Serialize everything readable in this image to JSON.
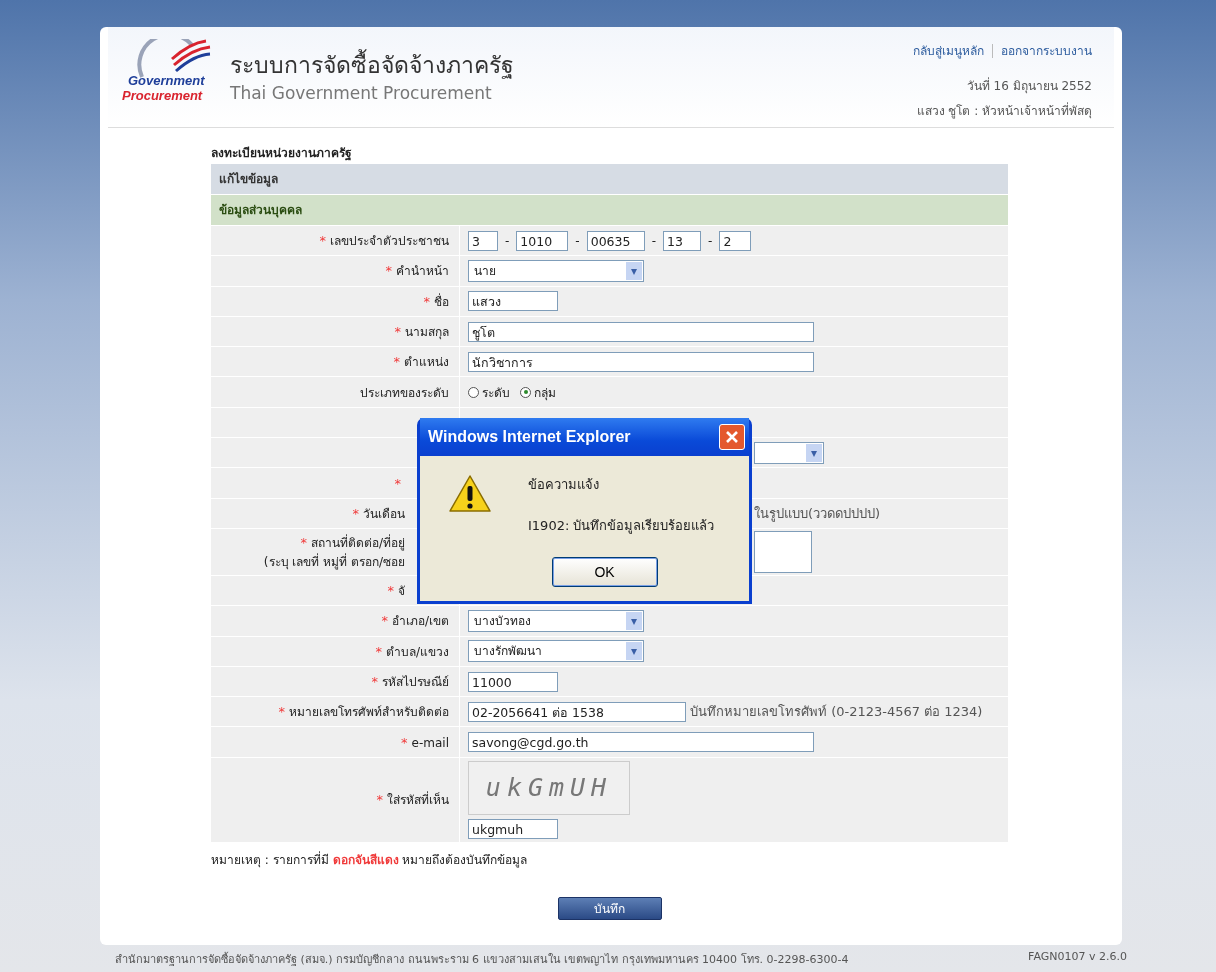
{
  "header": {
    "logo": {
      "line_1": "Government",
      "line_2": "Procurement"
    },
    "title": "ระบบการจัดซื้อจัดจ้างภาครัฐ",
    "subtitle": "Thai Government Procurement",
    "links": [
      "กลับสู่เมนูหลัก",
      "ออกจากระบบงาน"
    ],
    "date": "วันที่ 16 มิถุนายน 2552",
    "user": "แสวง ชูโต : หัวหน้าเจ้าหน้าที่พัสดุ"
  },
  "form": {
    "title": "ลงทะเบียนหน่วยงานภาครัฐ",
    "section": "แก้ไขข้อมูล",
    "subsection": "ข้อมูลส่วนบุคคล",
    "rows": [
      {
        "kind": "id",
        "label": "เลขประจำตัวประชาชน",
        "required": true,
        "obscured": false,
        "parts": [
          "3",
          "1010",
          "00635",
          "13",
          "2"
        ]
      },
      {
        "kind": "select",
        "label": "คำนำหน้า",
        "required": true,
        "obscured": false,
        "value": "นาย"
      },
      {
        "kind": "short_text",
        "label": "ชื่อ",
        "required": true,
        "obscured": false,
        "value": "แสวง"
      },
      {
        "kind": "text",
        "label": "นามสกุล",
        "required": true,
        "obscured": false,
        "value": "ชูโต"
      },
      {
        "kind": "text",
        "label": "ตำแหน่ง",
        "required": true,
        "obscured": false,
        "value": "นักวิชาการ"
      },
      {
        "kind": "radio",
        "label": "ประเภทของระดับ",
        "required": false,
        "obscured": false,
        "options": [
          {
            "label": "ระดับ",
            "selected": false
          },
          {
            "label": "กลุ่ม",
            "selected": true
          }
        ]
      },
      {
        "kind": "blank",
        "required": false
      },
      {
        "kind": "blank_select",
        "required": false,
        "obscured": true
      },
      {
        "kind": "blank",
        "required": true,
        "obscured": true
      },
      {
        "kind": "hint",
        "label": "วันเดือน",
        "required": true,
        "obscured": true,
        "hint": "ในรูปแบบ(ววดดปปปป)"
      },
      {
        "kind": "textarea",
        "label": "สถานที่ติดต่อ/ที่อยู่",
        "label_2": "(ระบุ เลขที่ หมู่ที่ ตรอก/ซอย",
        "required": true,
        "obscured": true
      },
      {
        "kind": "blank",
        "label": "จั",
        "required": true,
        "obscured": true
      },
      {
        "kind": "select",
        "label": "อำเภอ/เขต",
        "required": true,
        "obscured": false,
        "value": "บางบัวทอง"
      },
      {
        "kind": "select",
        "label": "ตำบล/แขวง",
        "required": true,
        "obscured": false,
        "value": "บางรักพัฒนา"
      },
      {
        "kind": "short_text",
        "label": "รหัสไปรษณีย์",
        "required": true,
        "obscured": false,
        "value": "11000"
      },
      {
        "kind": "text_hint",
        "label": "หมายเลขโทรศัพท์สำหรับติดต่อ",
        "required": true,
        "obscured": false,
        "value": "02-2056641 ต่อ 1538",
        "hint": "บันทึกหมายเลขโทรศัพท์ (0-2123-4567 ต่อ 1234)"
      },
      {
        "kind": "text",
        "label": "e-mail",
        "required": true,
        "obscured": false,
        "value": "savong@cgd.go.th"
      },
      {
        "kind": "captcha",
        "label": "ใส่รหัสที่เห็น",
        "required": true,
        "obscured": false,
        "image_text": "ukGmUH",
        "value": "ukgmuh"
      }
    ],
    "required_mark": "*",
    "id_separator": "-",
    "dropdown_glyph": "▾",
    "note": "หมายเหตุ : รายการที่มี **ดอกจันสีแดง** หมายถึงต้องบันทึกข้อมูล",
    "save_button": "บันทึก"
  },
  "dialog": {
    "title": "Windows Internet Explorer",
    "heading": "ข้อความแจ้ง",
    "message": "I1902: บันทึกข้อมูลเรียบร้อยแล้ว",
    "button": "OK"
  },
  "footer": {
    "address": "สำนักมาตรฐานการจัดซื้อจัดจ้างภาครัฐ (สมจ.) กรมบัญชีกลาง ถนนพระราม 6 แขวงสามเสนใน เขตพญาไท กรุงเทพมหานคร 10400 โทร. 0-2298-6300-4",
    "version": "FAGN0107 v 2.6.0"
  }
}
